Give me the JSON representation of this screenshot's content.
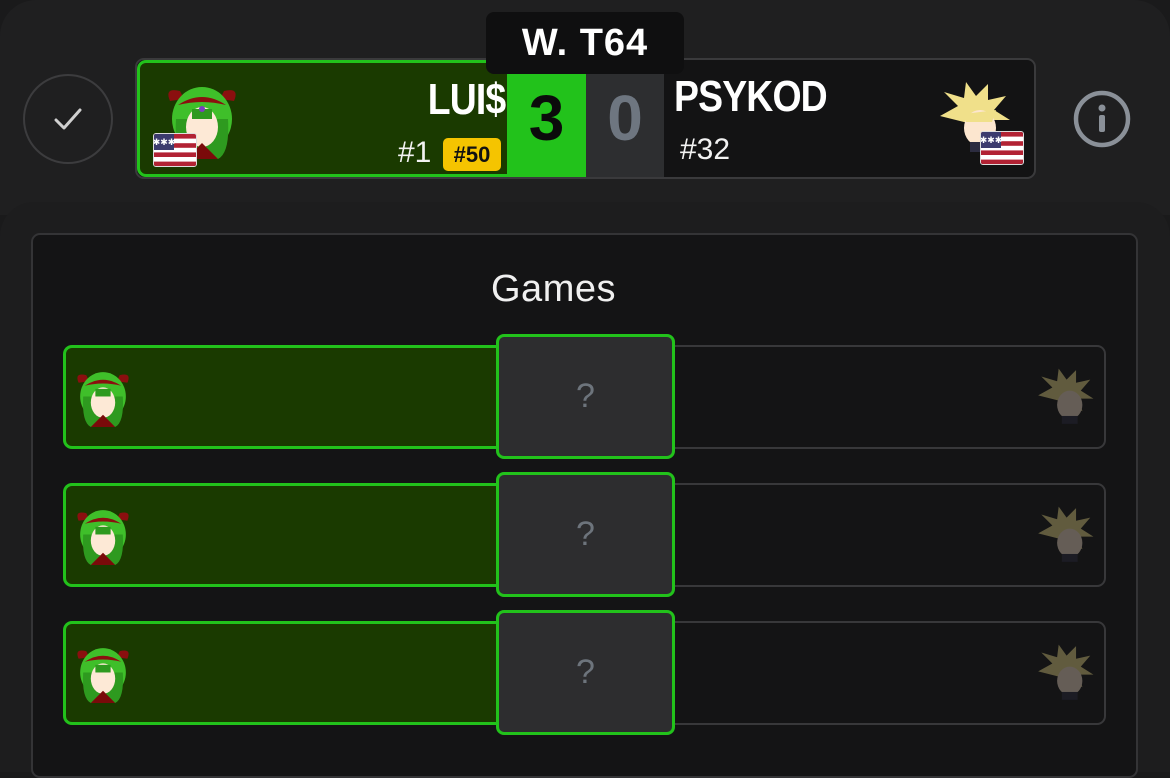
{
  "round": "W. T64",
  "player1": {
    "name": "LUI$",
    "seed": "#1",
    "badge": "#50",
    "score": "3",
    "character_icon": "green-haired-character-icon",
    "flag_icon": "us-flag-icon"
  },
  "player2": {
    "name": "PSYKOD",
    "seed": "#32",
    "score": "0",
    "character_icon": "blonde-spiky-character-icon",
    "flag_icon": "us-flag-icon"
  },
  "games": {
    "title": "Games",
    "rows": [
      {
        "result": "?"
      },
      {
        "result": "?"
      },
      {
        "result": "?"
      }
    ]
  },
  "colors": {
    "accent_green": "#22c21b",
    "winner_bg": "#1a3a00",
    "badge_yellow": "#f5c400"
  }
}
